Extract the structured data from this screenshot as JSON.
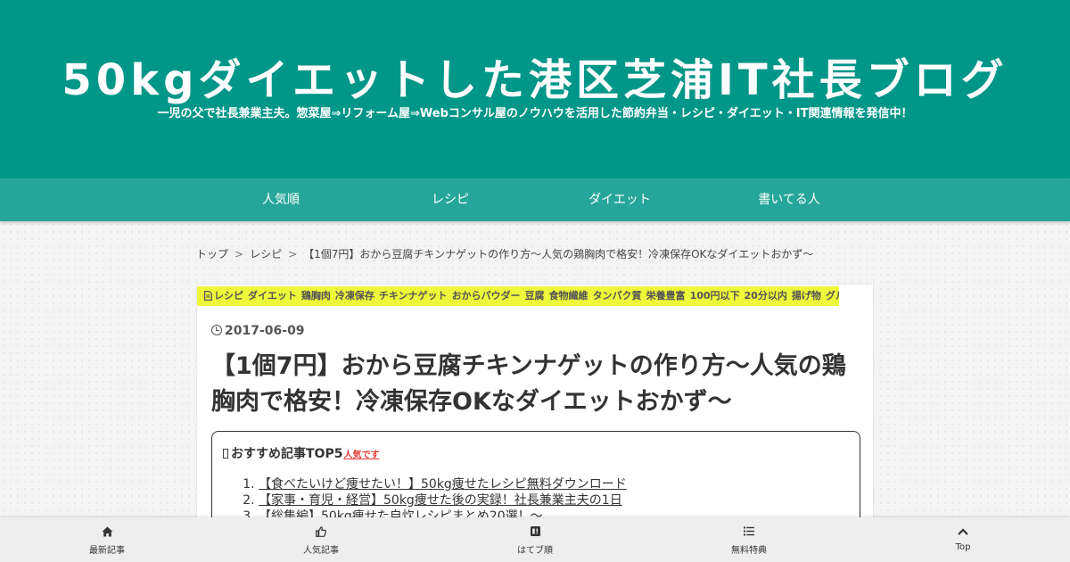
{
  "header": {
    "title": "50kgダイエットした港区芝浦IT社長ブログ",
    "tagline": "一児の父で社長兼業主夫。惣菜屋⇒リフォーム屋⇒Webコンサル屋のノウハウを活用した節約弁当・レシピ・ダイエット・IT関連情報を発信中！"
  },
  "nav": {
    "items": [
      {
        "label": "人気順"
      },
      {
        "label": "レシピ"
      },
      {
        "label": "ダイエット"
      },
      {
        "label": "書いてる人"
      }
    ]
  },
  "breadcrumb": {
    "home": "トップ",
    "category": "レシピ",
    "current": "【1個7円】おから豆腐チキンナゲットの作り方～人気の鶏胸肉で格安！冷凍保存OKなダイエットおかず～",
    "separator": ">"
  },
  "article": {
    "categories": [
      "レシピ",
      "ダイエット",
      "鶏胸肉",
      "冷凍保存",
      "チキンナゲット",
      "おからパウダー",
      "豆腐",
      "食物繊維",
      "タンパク質",
      "栄養豊富",
      "100円以下",
      "20分以内",
      "揚げ物",
      "グルメ"
    ],
    "date": "2017-06-09",
    "title": "【1個7円】おから豆腐チキンナゲットの作り方～人気の鶏胸肉で格安！冷凍保存OKなダイエットおかず～"
  },
  "toc": {
    "heading": "おすすめ記事TOP5",
    "badge": "人気です",
    "items": [
      "【食べたいけど痩せたい！】50kg痩せたレシピ無料ダウンロード",
      "【家事・育児・経営】50kg痩せた後の実録！社長兼業主夫の1日",
      "【総集編】50kg痩せた自炊レシピまとめ20選！～"
    ]
  },
  "bottom_bar": {
    "items": [
      {
        "label": "最新記事",
        "icon": "home-icon"
      },
      {
        "label": "人気記事",
        "icon": "thumbs-up-icon"
      },
      {
        "label": "はてブ順",
        "icon": "hatena-bookmark-icon"
      },
      {
        "label": "無料特典",
        "icon": "list-icon"
      },
      {
        "label": "Top",
        "icon": "chevron-up-icon"
      }
    ]
  },
  "colors": {
    "header_bg": "#009688",
    "nav_bg": "#26a69a",
    "category_bar": "#eef83a",
    "badge": "#e53935"
  }
}
